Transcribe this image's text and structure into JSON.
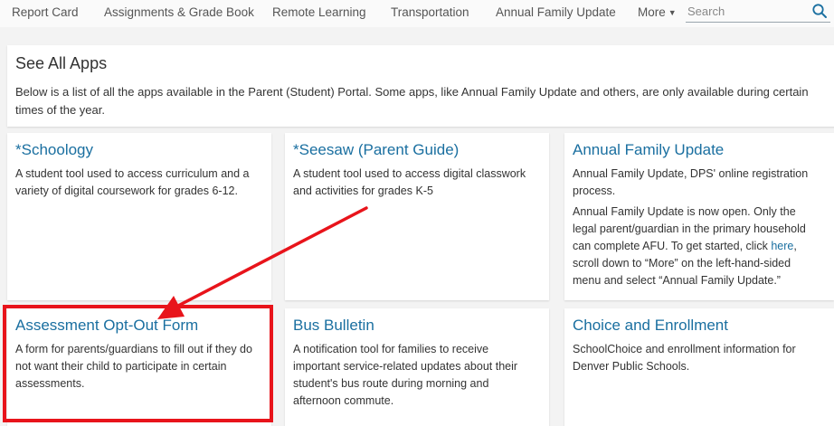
{
  "nav": {
    "items": [
      {
        "label": "Report Card"
      },
      {
        "label": "Assignments & Grade Book"
      },
      {
        "label": "Remote Learning"
      },
      {
        "label": "Transportation"
      },
      {
        "label": "Annual Family Update"
      }
    ],
    "more_label": "More",
    "more_caret": "▼",
    "search_placeholder": "Search",
    "search_icon": "search-icon"
  },
  "intro": {
    "title": "See All Apps",
    "description": "Below is a list of all the apps available in the Parent (Student) Portal. Some apps, like Annual Family Update and others, are only available during certain times of the year."
  },
  "apps": [
    {
      "title": "*Schoology",
      "lines": [
        "A student tool used to access curriculum and a",
        "variety of digital coursework for grades 6-12."
      ]
    },
    {
      "title": "*Seesaw (Parent Guide)",
      "lines": [
        "A student tool used to access digital classwork",
        "and activities for grades K-5"
      ]
    },
    {
      "title": "Annual Family Update",
      "lines": [
        "Annual Family Update, DPS' online registration",
        "process."
      ],
      "extra": {
        "line1": "Annual Family Update is now open. Only the",
        "line2": "legal parent/guardian in the primary household",
        "line3_pre": "can complete AFU. To get started, click ",
        "link": "here",
        "line3_post": ",",
        "line4": "scroll down to “More” on the left-hand-sided",
        "line5": "menu and select “Annual Family Update.”"
      }
    },
    {
      "title": "Assessment Opt-Out Form",
      "lines": [
        "A form for parents/guardians to fill out if they do",
        "not want their child to participate in certain",
        "assessments."
      ]
    },
    {
      "title": "Bus Bulletin",
      "lines": [
        "A notification tool for families to receive",
        "important service-related updates about their",
        "student's bus route during morning and",
        "afternoon commute."
      ]
    },
    {
      "title": "Choice and Enrollment",
      "lines": [
        "SchoolChoice and enrollment information for",
        "Denver Public Schools."
      ]
    }
  ],
  "annotation": {
    "color": "#e8141b"
  }
}
